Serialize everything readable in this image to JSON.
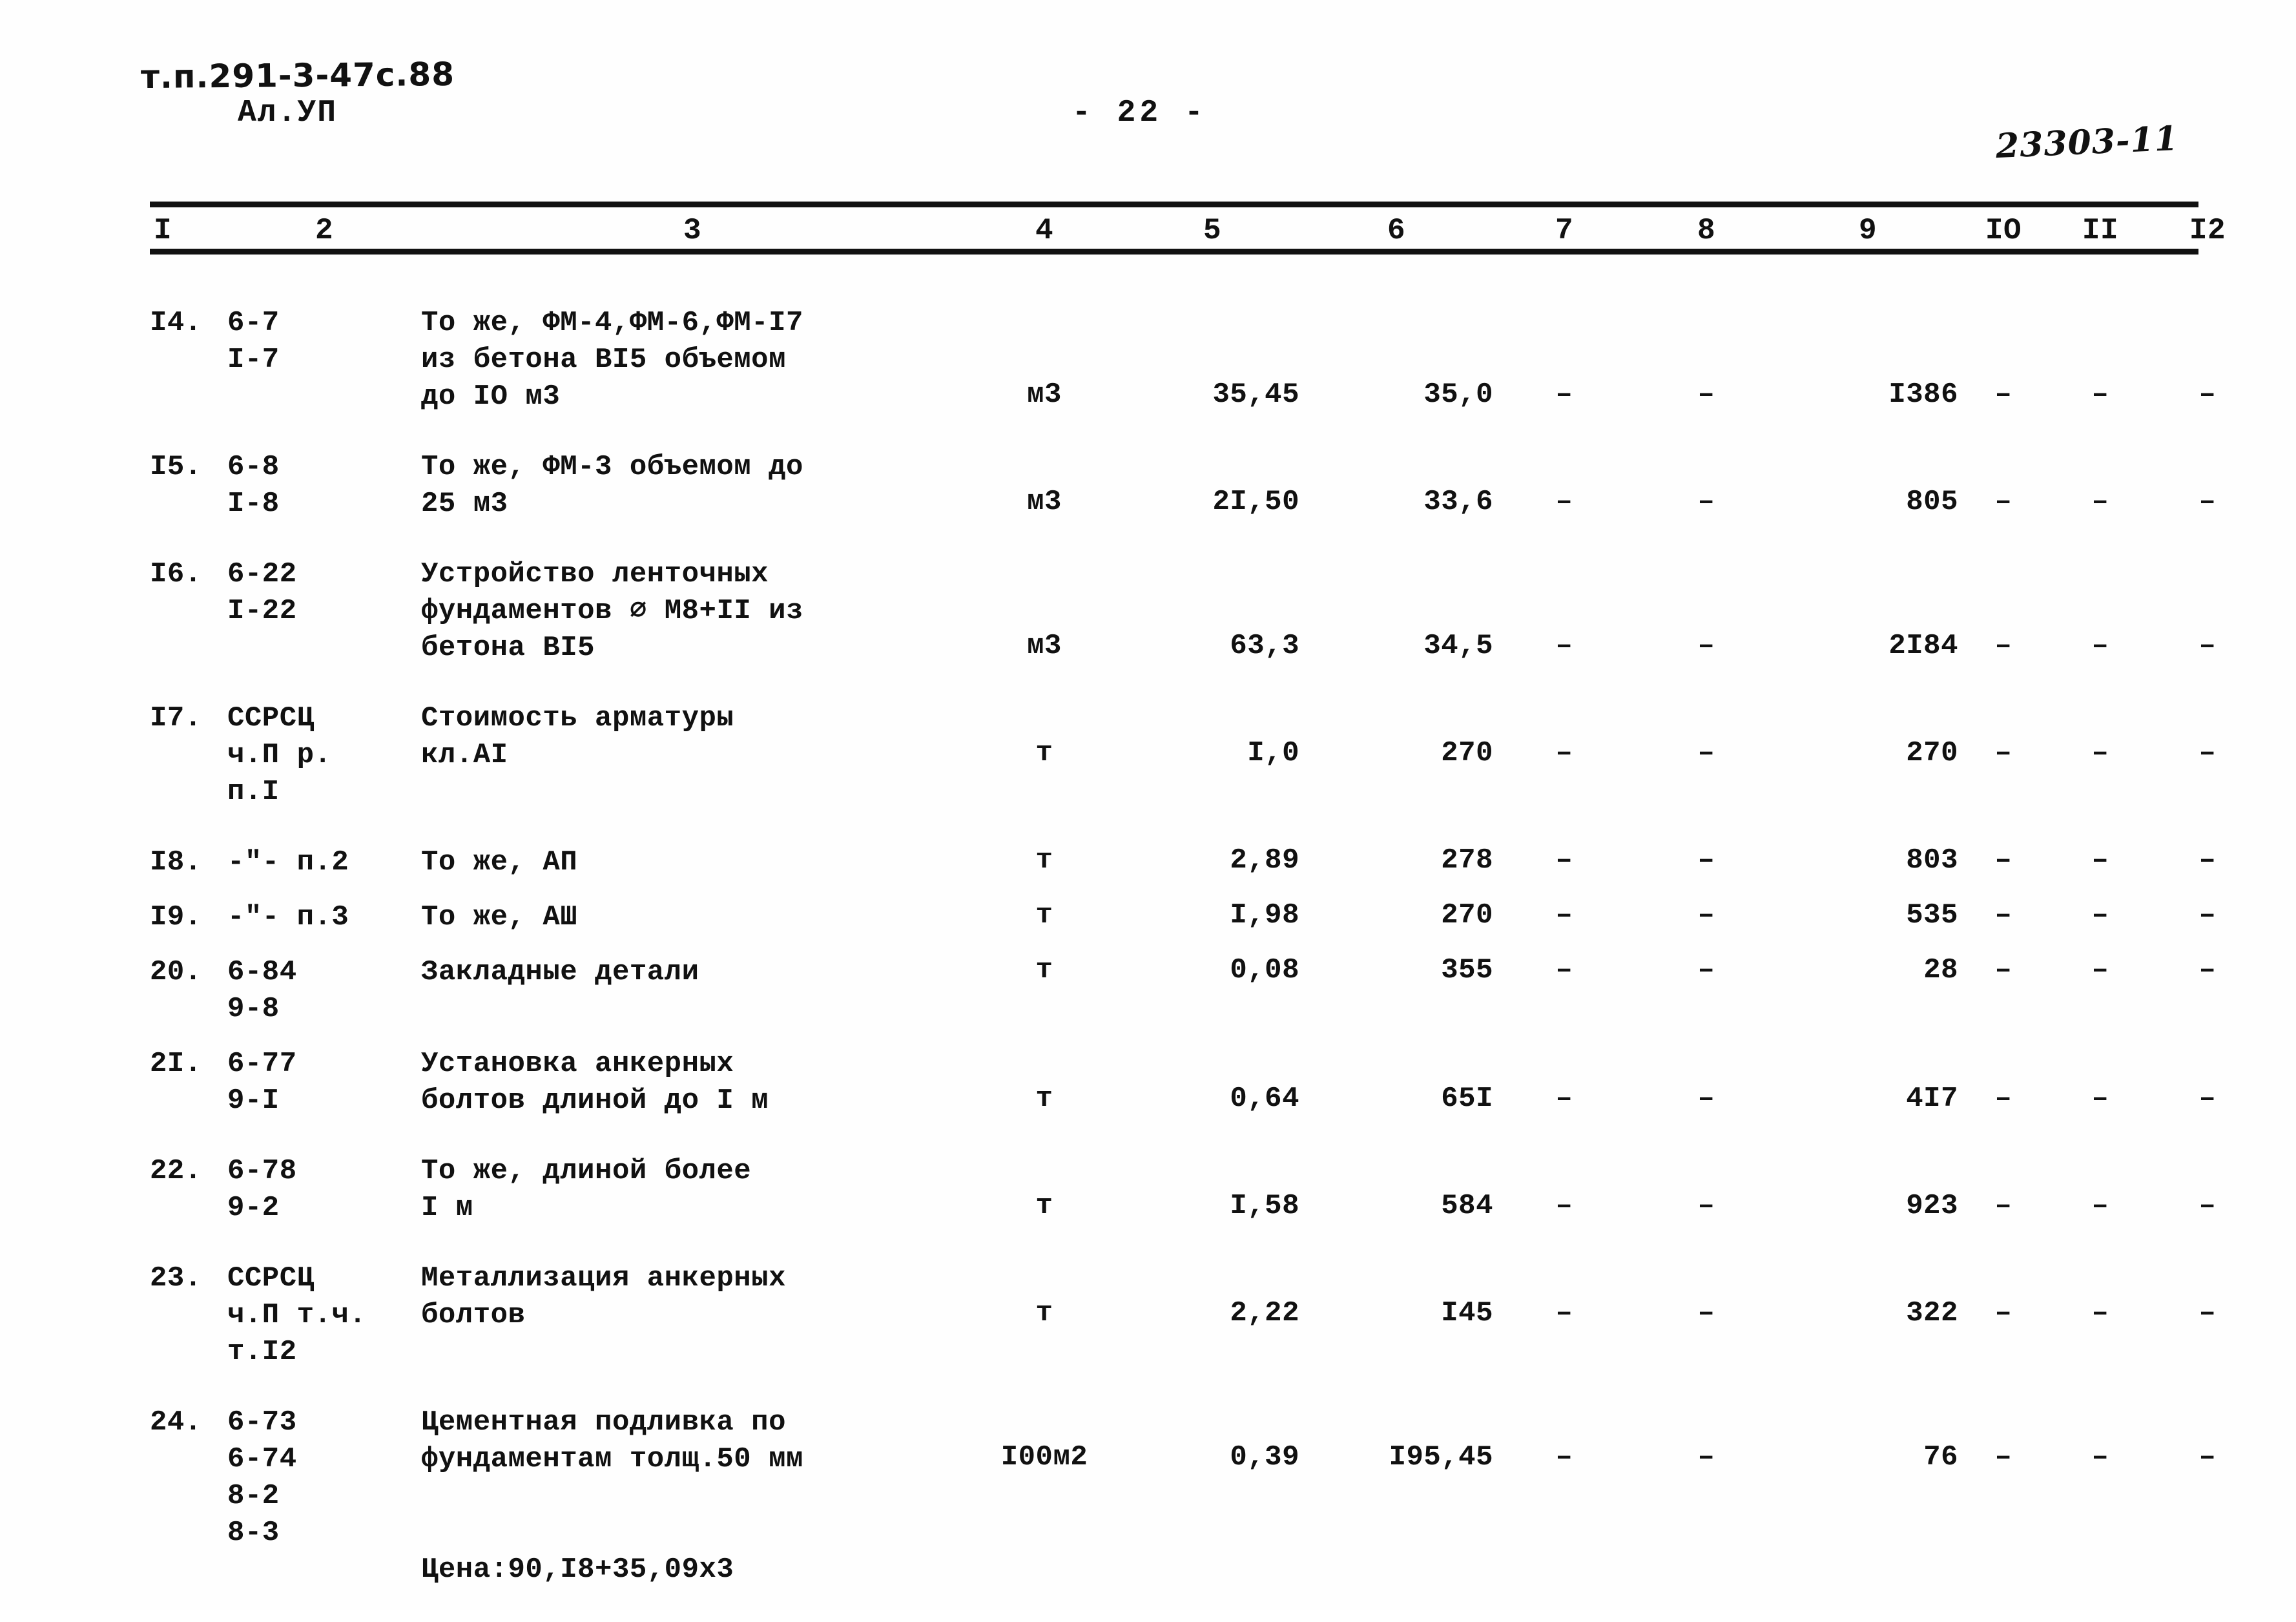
{
  "header": {
    "doc_code": "т.п.291-3-47с.88",
    "album_code": "Ал.УП",
    "page_number": "- 22 -",
    "archive_number": "23303-11"
  },
  "table": {
    "column_headers": [
      "I",
      "2",
      "3",
      "4",
      "5",
      "6",
      "7",
      "8",
      "9",
      "IO",
      "II",
      "I2"
    ],
    "rows": [
      {
        "no": "I4.",
        "justification": "6-7\nI-7",
        "description": "То же,  ФМ-4,ФМ-6,ФМ-I7\nиз бетона BI5 объемом\nдо IO м3",
        "unit": "м3",
        "c5": "35,45",
        "c6": "35,0",
        "c7": "–",
        "c8": "–",
        "c9": "I386",
        "c10": "–",
        "c11": "–",
        "c12": "–",
        "value_line": 3
      },
      {
        "no": "I5.",
        "justification": "6-8\nI-8",
        "description": "То же,  ФМ-3 объемом до\n25 м3",
        "unit": "м3",
        "c5": "2I,50",
        "c6": "33,6",
        "c7": "–",
        "c8": "–",
        "c9": "805",
        "c10": "–",
        "c11": "–",
        "c12": "–",
        "value_line": 2
      },
      {
        "no": "I6.",
        "justification": "6-22\nI-22",
        "description": "Устройство ленточных\nфундаментов ⌀ М8+II из\nбетона BI5",
        "unit": "м3",
        "c5": "63,3",
        "c6": "34,5",
        "c7": "–",
        "c8": "–",
        "c9": "2I84",
        "c10": "–",
        "c11": "–",
        "c12": "–",
        "value_line": 3
      },
      {
        "no": "I7.",
        "justification": "ССРСЦ\nч.П р.\nп.I",
        "description": "Стоимость арматуры\nкл.AI",
        "unit": "т",
        "c5": "I,0",
        "c6": "270",
        "c7": "–",
        "c8": "–",
        "c9": "270",
        "c10": "–",
        "c11": "–",
        "c12": "–",
        "value_line": 2
      },
      {
        "no": "I8.",
        "justification": "-\"- п.2",
        "description": "То же, АП",
        "unit": "т",
        "c5": "2,89",
        "c6": "278",
        "c7": "–",
        "c8": "–",
        "c9": "803",
        "c10": "–",
        "c11": "–",
        "c12": "–",
        "value_line": 1
      },
      {
        "no": "I9.",
        "justification": "-\"- п.3",
        "description": "То же, АШ",
        "unit": "т",
        "c5": "I,98",
        "c6": "270",
        "c7": "–",
        "c8": "–",
        "c9": "535",
        "c10": "–",
        "c11": "–",
        "c12": "–",
        "value_line": 1
      },
      {
        "no": "20.",
        "justification": "6-84\n9-8",
        "description": "Закладные детали",
        "unit": "т",
        "c5": "0,08",
        "c6": "355",
        "c7": "–",
        "c8": "–",
        "c9": "28",
        "c10": "–",
        "c11": "–",
        "c12": "–",
        "value_line": 1
      },
      {
        "no": "2I.",
        "justification": "6-77\n9-I",
        "description": "Установка анкерных\nболтов длиной до I м",
        "unit": "т",
        "c5": "0,64",
        "c6": "65I",
        "c7": "–",
        "c8": "–",
        "c9": "4I7",
        "c10": "–",
        "c11": "–",
        "c12": "–",
        "value_line": 2
      },
      {
        "no": "22.",
        "justification": "6-78\n9-2",
        "description": "То же, длиной более\nI м",
        "unit": "т",
        "c5": "I,58",
        "c6": "584",
        "c7": "–",
        "c8": "–",
        "c9": "923",
        "c10": "–",
        "c11": "–",
        "c12": "–",
        "value_line": 2
      },
      {
        "no": "23.",
        "justification": "ССРСЦ\nч.П т.ч.\nт.I2",
        "description": "Металлизация анкерных\nболтов",
        "unit": "т",
        "c5": "2,22",
        "c6": "I45",
        "c7": "–",
        "c8": "–",
        "c9": "322",
        "c10": "–",
        "c11": "–",
        "c12": "–",
        "value_line": 2
      },
      {
        "no": "24.",
        "justification": "6-73\n6-74\n8-2\n8-3",
        "description": "Цементная подливка по\nфундаментам толщ.50 мм",
        "unit": "I00м2",
        "c5": "0,39",
        "c6": "I95,45",
        "c7": "–",
        "c8": "–",
        "c9": "76",
        "c10": "–",
        "c11": "–",
        "c12": "–",
        "value_line": 2,
        "price_note": "Цена:90,I8+35,09х3"
      }
    ]
  }
}
